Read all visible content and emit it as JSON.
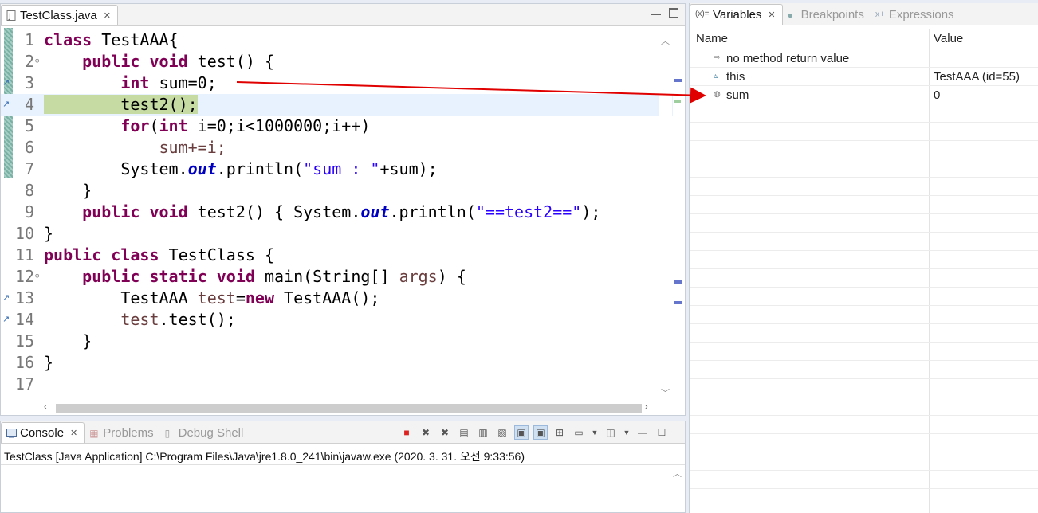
{
  "editor": {
    "tab_label": "TestClass.java",
    "lines": [
      {
        "num": "1"
      },
      {
        "num": "2"
      },
      {
        "num": "3"
      },
      {
        "num": "4"
      },
      {
        "num": "5"
      },
      {
        "num": "6"
      },
      {
        "num": "7"
      },
      {
        "num": "8"
      },
      {
        "num": "9"
      },
      {
        "num": "10"
      },
      {
        "num": "11"
      },
      {
        "num": "12"
      },
      {
        "num": "13"
      },
      {
        "num": "14"
      },
      {
        "num": "15"
      },
      {
        "num": "16"
      },
      {
        "num": "17"
      }
    ],
    "tokens": {
      "l1_kw": "class",
      "l1_rest": " TestAAA{",
      "l2_kw1": "public",
      "l2_kw2": "void",
      "l2_rest": " test() {",
      "l3_kw": "int",
      "l3_rest": " sum=0;",
      "l4_hl": "test2();",
      "l5_kw1": "for",
      "l5_mid": "(",
      "l5_kw2": "int",
      "l5_rest": " i=0;i<1000000;i++)",
      "l6_rest": "sum+=i;",
      "l7_a": "System.",
      "l7_fld": "out",
      "l7_b": ".println(",
      "l7_str": "\"sum : \"",
      "l7_c": "+sum);",
      "l8_rest": "}",
      "l9_kw1": "public",
      "l9_kw2": "void",
      "l9_a": " test2() { System.",
      "l9_fld": "out",
      "l9_b": ".println(",
      "l9_str": "\"==test2==\"",
      "l9_c": ");",
      "l10_rest": "}",
      "l11_kw1": "public",
      "l11_kw2": "class",
      "l11_rest": " TestClass {",
      "l12_kw1": "public",
      "l12_kw2": "static",
      "l12_kw3": "void",
      "l12_a": " main(String[] ",
      "l12_loc": "args",
      "l12_b": ") {",
      "l13_a": "TestAAA ",
      "l13_loc": "test",
      "l13_b": "=",
      "l13_kw": "new",
      "l13_c": " TestAAA();",
      "l14_loc": "test",
      "l14_a": ".test();",
      "l15_rest": "}",
      "l16_rest": "}"
    }
  },
  "variables_panel": {
    "tabs": [
      {
        "label": "Variables",
        "icon": "variables-icon",
        "active": true
      },
      {
        "label": "Breakpoints",
        "icon": "breakpoints-icon",
        "active": false
      },
      {
        "label": "Expressions",
        "icon": "expressions-icon",
        "active": false
      }
    ],
    "columns": {
      "name": "Name",
      "value": "Value"
    },
    "rows": [
      {
        "name": "no method return value",
        "value": "",
        "icon": "return-value-icon"
      },
      {
        "name": "this",
        "value": "TestAAA  (id=55)",
        "icon": "field-icon"
      },
      {
        "name": "sum",
        "value": "0",
        "icon": "local-variable-icon"
      }
    ]
  },
  "console_panel": {
    "tabs": [
      {
        "label": "Console",
        "icon": "console-icon",
        "active": true
      },
      {
        "label": "Problems",
        "icon": "problems-icon",
        "active": false
      },
      {
        "label": "Debug Shell",
        "icon": "debug-shell-icon",
        "active": false
      }
    ],
    "launch_line": "TestClass [Java Application] C:\\Program Files\\Java\\jre1.8.0_241\\bin\\javaw.exe (2020. 3. 31. 오전 9:33:56)"
  },
  "colors": {
    "keyword": "#7f0055",
    "string": "#2a00ff",
    "field": "#0000c0",
    "highlight": "#c6dba4",
    "current_line": "#e8f2fe",
    "annotation_arrow": "#e00000"
  }
}
